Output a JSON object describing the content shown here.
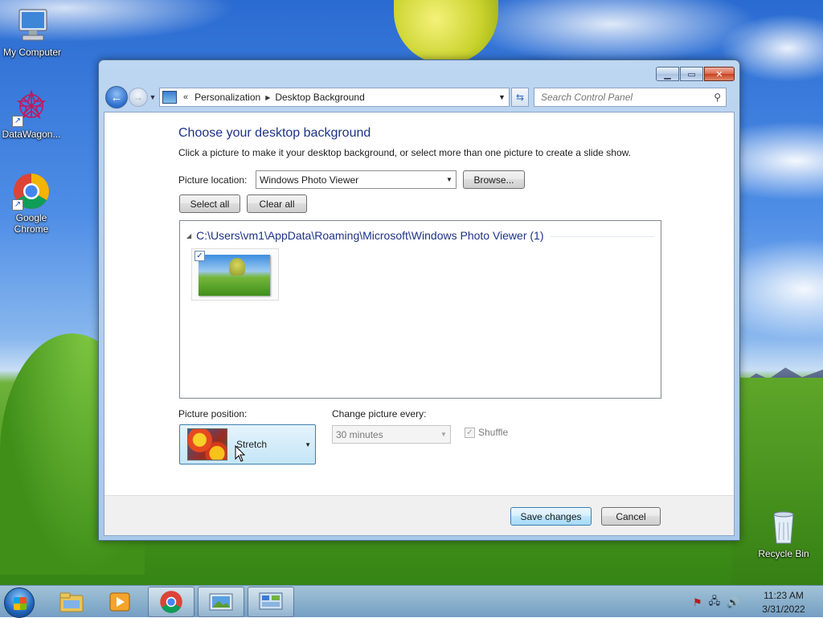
{
  "desktop": {
    "icons": [
      {
        "label": "My Computer"
      },
      {
        "label": "DataWagon..."
      },
      {
        "label": "Google Chrome"
      },
      {
        "label": "Recycle Bin"
      }
    ]
  },
  "window": {
    "breadcrumb": [
      "Personalization",
      "Desktop Background"
    ],
    "breadcrumb_prefix": "«",
    "search_placeholder": "Search Control Panel",
    "heading": "Choose your desktop background",
    "subtitle": "Click a picture to make it your desktop background, or select more than one picture to create a slide show.",
    "picture_location_label": "Picture location:",
    "picture_location_value": "Windows Photo Viewer",
    "browse_label": "Browse...",
    "select_all_label": "Select all",
    "clear_all_label": "Clear all",
    "gallery": {
      "group_title": "C:\\Users\\vm1\\AppData\\Roaming\\Microsoft\\Windows Photo Viewer (1)",
      "items": [
        {
          "checked": true
        }
      ]
    },
    "picture_position_label": "Picture position:",
    "picture_position_value": "Stretch",
    "change_every_label": "Change picture every:",
    "change_every_value": "30 minutes",
    "shuffle_label": "Shuffle",
    "shuffle_checked": true,
    "save_label": "Save changes",
    "cancel_label": "Cancel"
  },
  "taskbar": {
    "time": "11:23 AM",
    "date": "3/31/2022",
    "pinned": [
      "windows-explorer-icon",
      "media-player-icon",
      "chrome-icon",
      "photo-viewer-icon",
      "control-panel-icon"
    ]
  },
  "colors": {
    "heading": "#1e3287",
    "window_frame": "#bdd6f1",
    "save_button": "#bee6fd"
  }
}
